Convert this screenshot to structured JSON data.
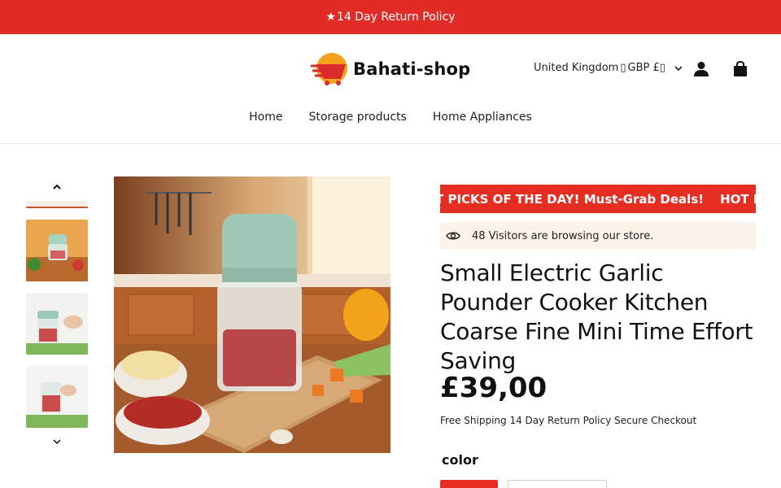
{
  "announcement": {
    "star": "★",
    "text": "14 Day Return Policy"
  },
  "header": {
    "logo_text": "Bahati-shop",
    "locale": "United Kingdom",
    "currency": "GBP £"
  },
  "nav": [
    "Home",
    "Storage products",
    "Home Appliances"
  ],
  "product": {
    "hot_banner": [
      "T PICKS OF THE DAY! Must-Grab Deals!",
      "HOT PICKS"
    ],
    "visitors_text": "48 Visitors are browsing our store.",
    "title": "Small Electric Garlic Pounder Cooker Kitchen Coarse Fine Mini Time Effort Saving",
    "price": "£39,00",
    "perks": " Free Shipping  14 Day Return Policy  Secure Checkout",
    "option_label": "color"
  },
  "colors": {
    "brand_red": "#e02b27",
    "banner_red": "#e52d21",
    "visitor_bg": "#fdf3ea"
  }
}
